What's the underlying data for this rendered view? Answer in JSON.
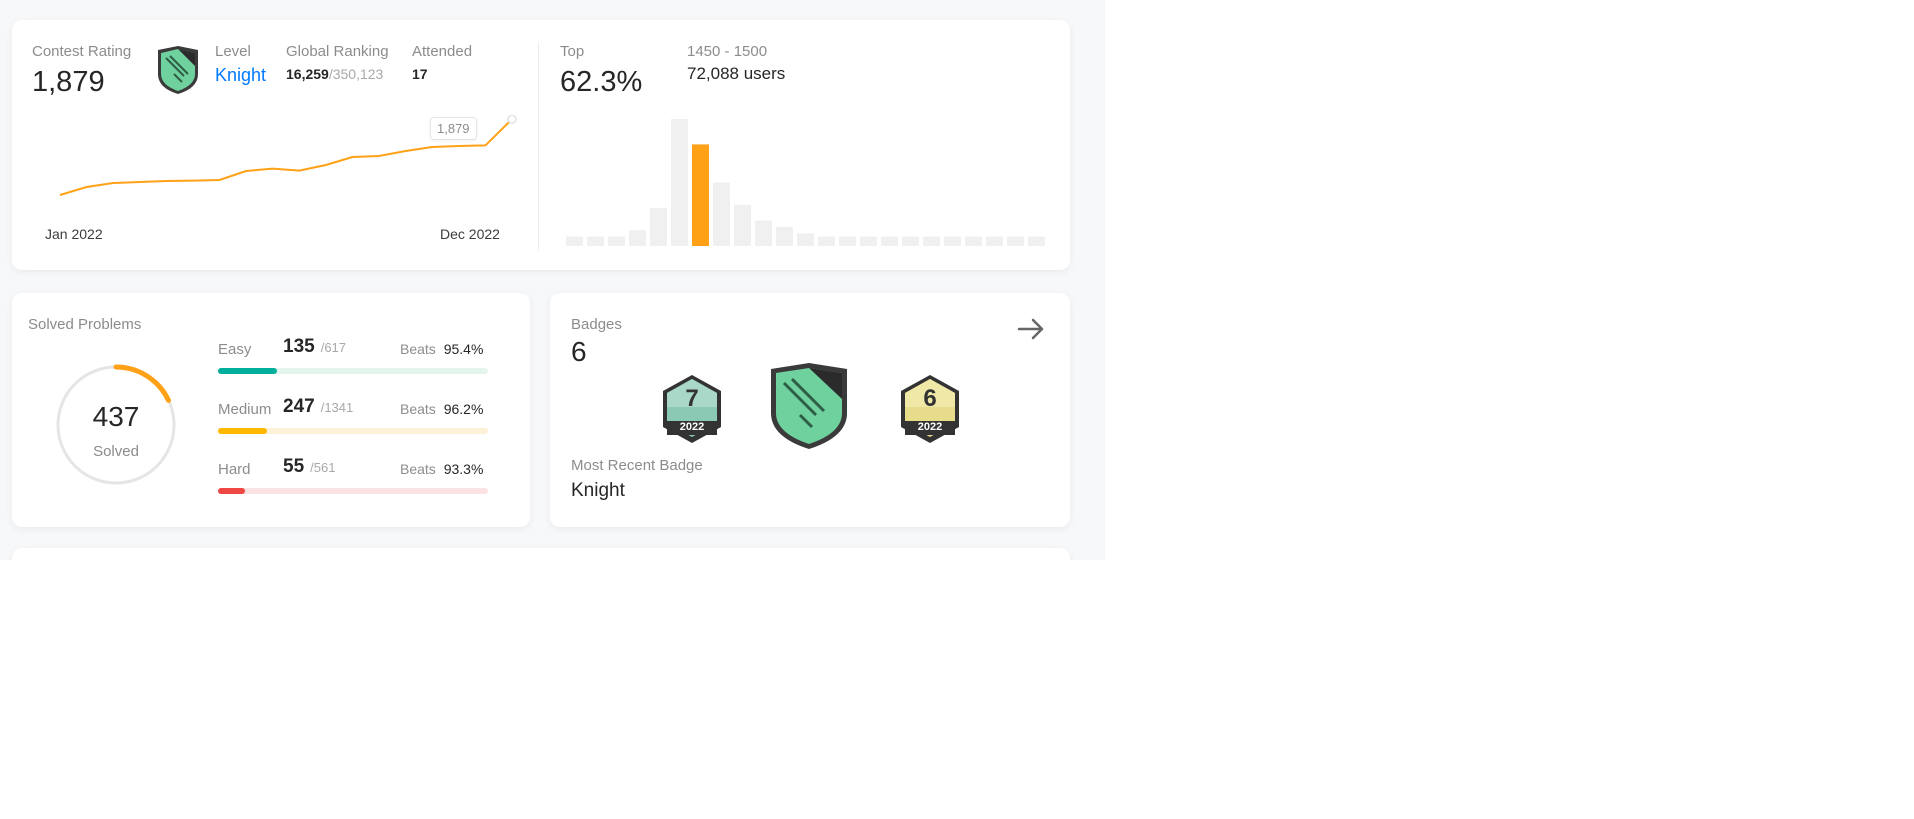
{
  "contest": {
    "rating_label": "Contest Rating",
    "rating_value": "1,879",
    "level_label": "Level",
    "level_value": "Knight",
    "global_ranking_label": "Global Ranking",
    "global_ranking_value": "16,259",
    "global_ranking_total": "/350,123",
    "attended_label": "Attended",
    "attended_value": "17",
    "chart_tooltip": "1,879",
    "x_start": "Jan 2022",
    "x_end": "Dec 2022",
    "top_label": "Top",
    "top_value": "62.3%",
    "range_label": "1450 - 1500",
    "range_users": "72,088 users",
    "accent_color": "#ffa116",
    "link_color": "#007aff"
  },
  "chart_data": [
    {
      "type": "line",
      "x": [
        "Jan 2022",
        "",
        "",
        "",
        "",
        "",
        "",
        "",
        "",
        "",
        "",
        "",
        "",
        "",
        "",
        "",
        "",
        "Dec 2022"
      ],
      "series": [
        {
          "values": [
            1500,
            1540,
            1560,
            1565,
            1570,
            1572,
            1575,
            1620,
            1632,
            1622,
            1650,
            1690,
            1695,
            1720,
            1740,
            1745,
            1748,
            1879
          ]
        }
      ],
      "annotation": "1,879"
    },
    {
      "type": "bar",
      "values": [
        3,
        3,
        3,
        5,
        12,
        40,
        32,
        20,
        13,
        8,
        6,
        4,
        3,
        3,
        3,
        3,
        3,
        3,
        3,
        3,
        3,
        3,
        3
      ],
      "highlight_index": 6,
      "highlight_label": "1450 - 1500"
    }
  ],
  "solved": {
    "title": "Solved Problems",
    "total": "437",
    "total_label": "Solved",
    "ring_fraction": 0.18,
    "rows": [
      {
        "name": "Easy",
        "count": "135",
        "total": "/617",
        "beats_label": "Beats",
        "beats": "95.4%",
        "fraction": 0.22,
        "color": "#00af9b",
        "track": "#e3f5ed"
      },
      {
        "name": "Medium",
        "count": "247",
        "total": "/1341",
        "beats_label": "Beats",
        "beats": "96.2%",
        "fraction": 0.18,
        "color": "#ffb800",
        "track": "#fdf1d8"
      },
      {
        "name": "Hard",
        "count": "55",
        "total": "/561",
        "beats_label": "Beats",
        "beats": "93.3%",
        "fraction": 0.1,
        "color": "#ef4743",
        "track": "#fbe3e3"
      }
    ]
  },
  "badges": {
    "title": "Badges",
    "count": "6",
    "badge1_num": "7",
    "badge1_year": "2022",
    "badge3_num": "6",
    "badge3_year": "2022",
    "recent_label": "Most Recent Badge",
    "recent_value": "Knight"
  }
}
